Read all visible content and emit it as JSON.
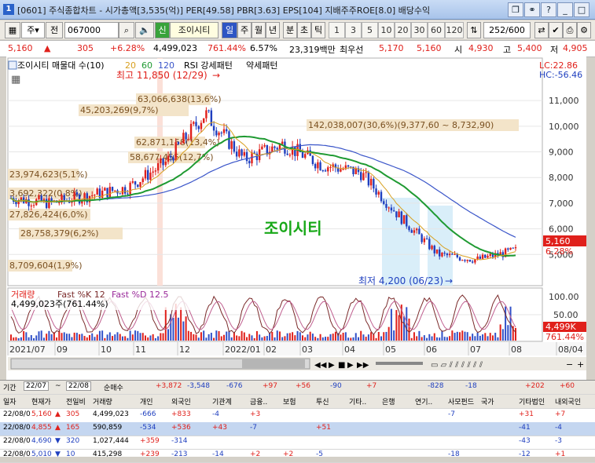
{
  "window": {
    "title": "[0601] 주식종합차트 - 시가총액[3,535(억)] PER[49.58] PBR[3.63] EPS[104] 지배주주ROE[8.0] 배당수익",
    "icon_letter": "1"
  },
  "toolbar": {
    "type_select": "주",
    "prev_button": "전",
    "code_value": "067000",
    "new_badge": "신",
    "name_value": "조이시티",
    "tabs": [
      "일",
      "주",
      "월",
      "년",
      "분",
      "초",
      "틱"
    ],
    "active_tab": "일",
    "periods": [
      "1",
      "3",
      "5",
      "10",
      "20",
      "30",
      "60",
      "120"
    ],
    "count_value": "252",
    "count_total": "/600"
  },
  "pricebar": {
    "price": "5,160",
    "change": "305",
    "change_pct": "+6.28%",
    "volume": "4,499,023",
    "turnover_pct": "761.44%",
    "ratio": "6.57%",
    "amount": "23,319백만",
    "pref_label": "최우선",
    "ask": "5,170",
    "bid": "5,160",
    "open_label": "시",
    "open": "4,930",
    "high_label": "고",
    "high": "5,400",
    "low_label": "저",
    "low": "4,905"
  },
  "chart": {
    "legend": {
      "name": "조이시티 매물대 수(10)",
      "ma20": "20",
      "ma60": "60",
      "ma120": "120",
      "rsi": "RSI 강세패턴",
      "weak": "약세패턴"
    },
    "lc": "LC:22.86",
    "hc": "HC:-56.46",
    "watermark": "조이시티",
    "high_marker": "최고 11,850 (12/29)",
    "low_marker": "최저 4,200 (06/23)",
    "price_tag": "5,160",
    "pct_tag": "6.28%",
    "vol_tag": "4,499K",
    "vol_pct_tag": "761.44%",
    "volume_legend": {
      "vol": "거래량",
      "k": "Fast %K 12",
      "d": "Fast %D 12.5"
    },
    "volume_value": "4,499,023주(761.44%)",
    "y_axis": [
      "11,000",
      "10,000",
      "9,000",
      "8,000",
      "7,000",
      "6,000",
      "5,000"
    ],
    "vol_axis": [
      "100.00",
      "50.00"
    ],
    "x_axis": [
      "2021/07",
      "09",
      "10",
      "11",
      "12",
      "2022/01",
      "02",
      "03",
      "04",
      "05",
      "06",
      "07",
      "08",
      "08/04"
    ],
    "volume_profile": [
      {
        "label": "63,066,638(13,6%)"
      },
      {
        "label": "45,203,269(9,7%)"
      },
      {
        "label": "62,871,158(13,4%)"
      },
      {
        "label": "58,677,455(12,7%)"
      },
      {
        "label": "23,974,623(5,1%)"
      },
      {
        "label": "3,692,322(0,8%)"
      },
      {
        "label": "27,826,424(6,0%)"
      },
      {
        "label": "28,758,379(6,2%)"
      },
      {
        "label": "8,709,604(1,9%)"
      },
      {
        "label": "142,038,007(30,6%)(9,377,60 ~ 8,732,90)"
      }
    ]
  },
  "chart_data": {
    "type": "candlestick",
    "symbol": "조이시티",
    "y_range": [
      4000,
      11800
    ],
    "months": [
      "2021/07",
      "09",
      "10",
      "11",
      "12",
      "2022/01",
      "02",
      "03",
      "04",
      "05",
      "06",
      "07",
      "08"
    ],
    "close_approx": [
      7200,
      7000,
      7300,
      7600,
      8600,
      10500,
      8700,
      9300,
      8500,
      8200,
      6500,
      5000,
      4800,
      5160
    ],
    "high": 11850,
    "low": 4200,
    "last_close": 5160
  },
  "grid": {
    "date_from": "22/07",
    "date_to": "22/08",
    "net_label": "순매수",
    "summary": [
      "+3,872",
      "-3,548",
      "-676",
      "+97",
      "+56",
      "-90",
      "+7",
      "-828",
      "-18",
      "+202",
      "+60"
    ],
    "headers": [
      "일자",
      "현재가",
      "전일비",
      "거래량",
      "개인",
      "외국인",
      "기관계",
      "금융..",
      "보험",
      "투신",
      "기타..",
      "은행",
      "연기..",
      "사모펀드",
      "국가",
      "기타법인",
      "내외국인"
    ],
    "rows": [
      {
        "date": "22/08/0",
        "price": "5,160",
        "diff": "305",
        "vol": "4,499,023",
        "ind": "-666",
        "frn": "+833",
        "inst": "-4",
        "c1": "+3",
        "c2": "",
        "c3": "",
        "c4": "",
        "c5": "",
        "c6": "",
        "c7": "-7",
        "c8": "",
        "c9": "+31",
        "c10": "+7"
      },
      {
        "date": "22/08/0",
        "price": "4,855",
        "diff": "165",
        "vol": "590,859",
        "ind": "-534",
        "frn": "+536",
        "inst": "+43",
        "c1": "-7",
        "c2": "",
        "c3": "+51",
        "c4": "",
        "c5": "",
        "c6": "",
        "c7": "",
        "c8": "",
        "c9": "-41",
        "c10": "-4"
      },
      {
        "date": "22/08/0",
        "price": "4,690",
        "diff": "320",
        "vol": "1,027,444",
        "ind": "+359",
        "frn": "-314",
        "inst": "",
        "c1": "",
        "c2": "",
        "c3": "",
        "c4": "",
        "c5": "",
        "c6": "",
        "c7": "",
        "c8": "",
        "c9": "-43",
        "c10": "-3"
      },
      {
        "date": "22/08/0",
        "price": "5,010",
        "diff": "10",
        "vol": "415,298",
        "ind": "+239",
        "frn": "-213",
        "inst": "-14",
        "c1": "+2",
        "c2": "+2",
        "c3": "-5",
        "c4": "",
        "c5": "",
        "c6": "",
        "c7": "-18",
        "c8": "",
        "c9": "-12",
        "c10": "+1"
      }
    ]
  }
}
